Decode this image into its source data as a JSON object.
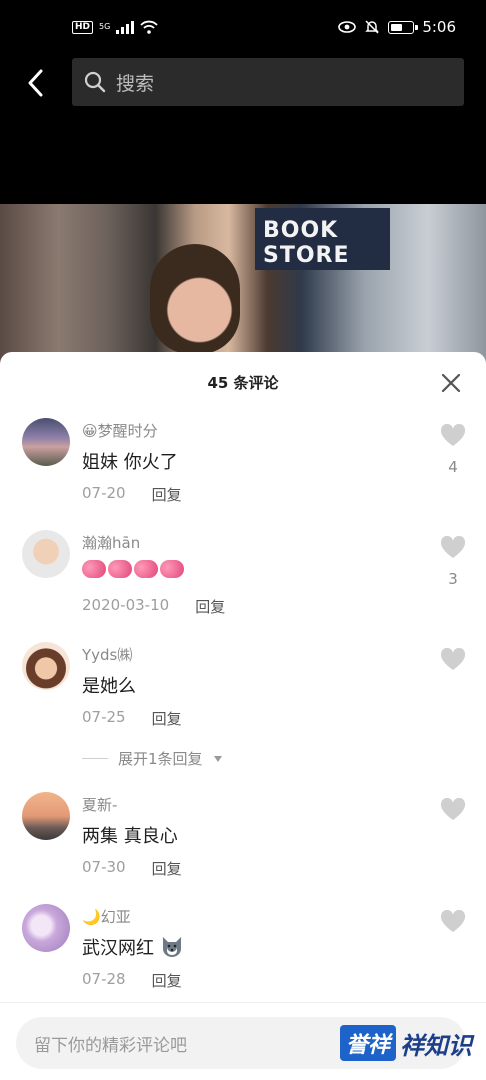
{
  "status_bar": {
    "hd": "HD",
    "network": "5G",
    "time": "5:06"
  },
  "search": {
    "placeholder": "搜索"
  },
  "video": {
    "shop_sign": "BOOK STORE"
  },
  "sheet": {
    "title": "45 条评论"
  },
  "comments": [
    {
      "user": "梦醒时分",
      "emoji": "😀",
      "text": "姐妹 你火了",
      "date": "07-20",
      "reply_label": "回复",
      "likes": "4"
    },
    {
      "user": "瀚瀚hān",
      "text": "",
      "date": "2020-03-10",
      "reply_label": "回复",
      "likes": "3"
    },
    {
      "user": "Yyds㈱",
      "text": "是她么",
      "date": "07-25",
      "reply_label": "回复",
      "likes": ""
    },
    {
      "user": "夏新-",
      "text": "两集 真良心",
      "date": "07-30",
      "reply_label": "回复",
      "likes": ""
    },
    {
      "user": "幻亚",
      "emoji": "🌙",
      "text": "武汉网红",
      "date": "07-28",
      "reply_label": "回复",
      "likes": ""
    }
  ],
  "expand": {
    "label": "展开1条回复"
  },
  "input": {
    "placeholder": "留下你的精彩评论吧"
  },
  "watermark": {
    "badge": "誉祥",
    "text": "祥知识"
  },
  "colors": {
    "accent_blue": "#1d63c9",
    "sheet_bg": "#ffffff",
    "muted_text": "#8a8a8a"
  }
}
